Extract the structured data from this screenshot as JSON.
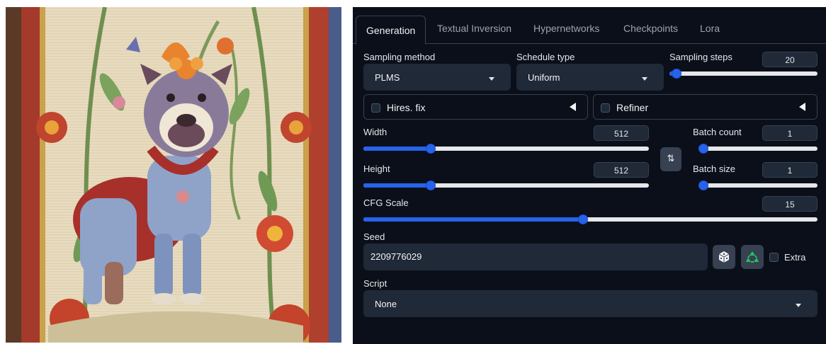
{
  "image": {
    "description_icon": "tapestry-bulldog-image"
  },
  "tabs": [
    {
      "label": "Generation",
      "active": true
    },
    {
      "label": "Textual Inversion",
      "active": false
    },
    {
      "label": "Hypernetworks",
      "active": false
    },
    {
      "label": "Checkpoints",
      "active": false
    },
    {
      "label": "Lora",
      "active": false
    }
  ],
  "sampling_method": {
    "label": "Sampling method",
    "value": "PLMS"
  },
  "schedule_type": {
    "label": "Schedule type",
    "value": "Uniform"
  },
  "sampling_steps": {
    "label": "Sampling steps",
    "value": "20",
    "fraction": 0.05
  },
  "hires_fix": {
    "label": "Hires. fix"
  },
  "refiner": {
    "label": "Refiner"
  },
  "width": {
    "label": "Width",
    "value": "512",
    "fraction": 0.235
  },
  "height": {
    "label": "Height",
    "value": "512",
    "fraction": 0.235
  },
  "batch_count": {
    "label": "Batch count",
    "value": "1",
    "fraction": 0
  },
  "batch_size": {
    "label": "Batch size",
    "value": "1",
    "fraction": 0
  },
  "swap_button": {
    "label": "⇅"
  },
  "cfg_scale": {
    "label": "CFG Scale",
    "value": "15",
    "fraction": 0.483
  },
  "seed": {
    "label": "Seed",
    "value": "2209776029"
  },
  "extra": {
    "label": "Extra"
  },
  "script": {
    "label": "Script",
    "value": "None"
  },
  "colors": {
    "accent": "#2563eb",
    "panel_bg": "#0b0f19",
    "input_bg": "#1f2937",
    "recycle": "#22c55e"
  }
}
